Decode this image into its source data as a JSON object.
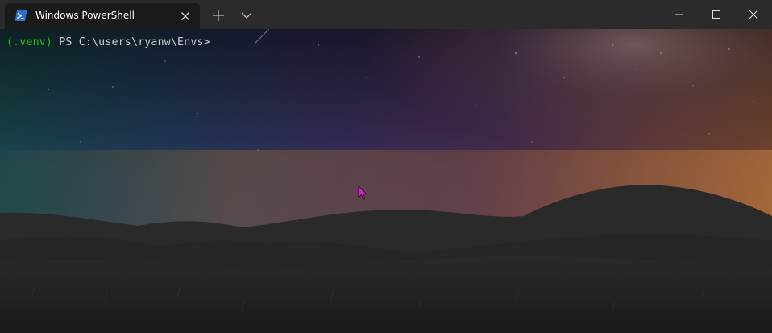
{
  "window": {
    "tab_title": "Windows PowerShell"
  },
  "icons": {
    "tab": "powershell-icon",
    "close_tab": "close-icon",
    "new_tab": "plus-icon",
    "dropdown": "chevron-down-icon",
    "minimize": "minimize-icon",
    "maximize": "maximize-icon",
    "close_window": "close-icon",
    "mouse": "mouse-pointer-icon"
  },
  "terminal": {
    "venv": "(.venv)",
    "prompt": " PS C:\\users\\ryanw\\Envs>"
  },
  "colors": {
    "titlebar": "#2b2b2b",
    "tab": "#1a1a1a",
    "venv": "#16c60c",
    "prompt_text": "#cccccc",
    "cursor": "#d020d0"
  }
}
